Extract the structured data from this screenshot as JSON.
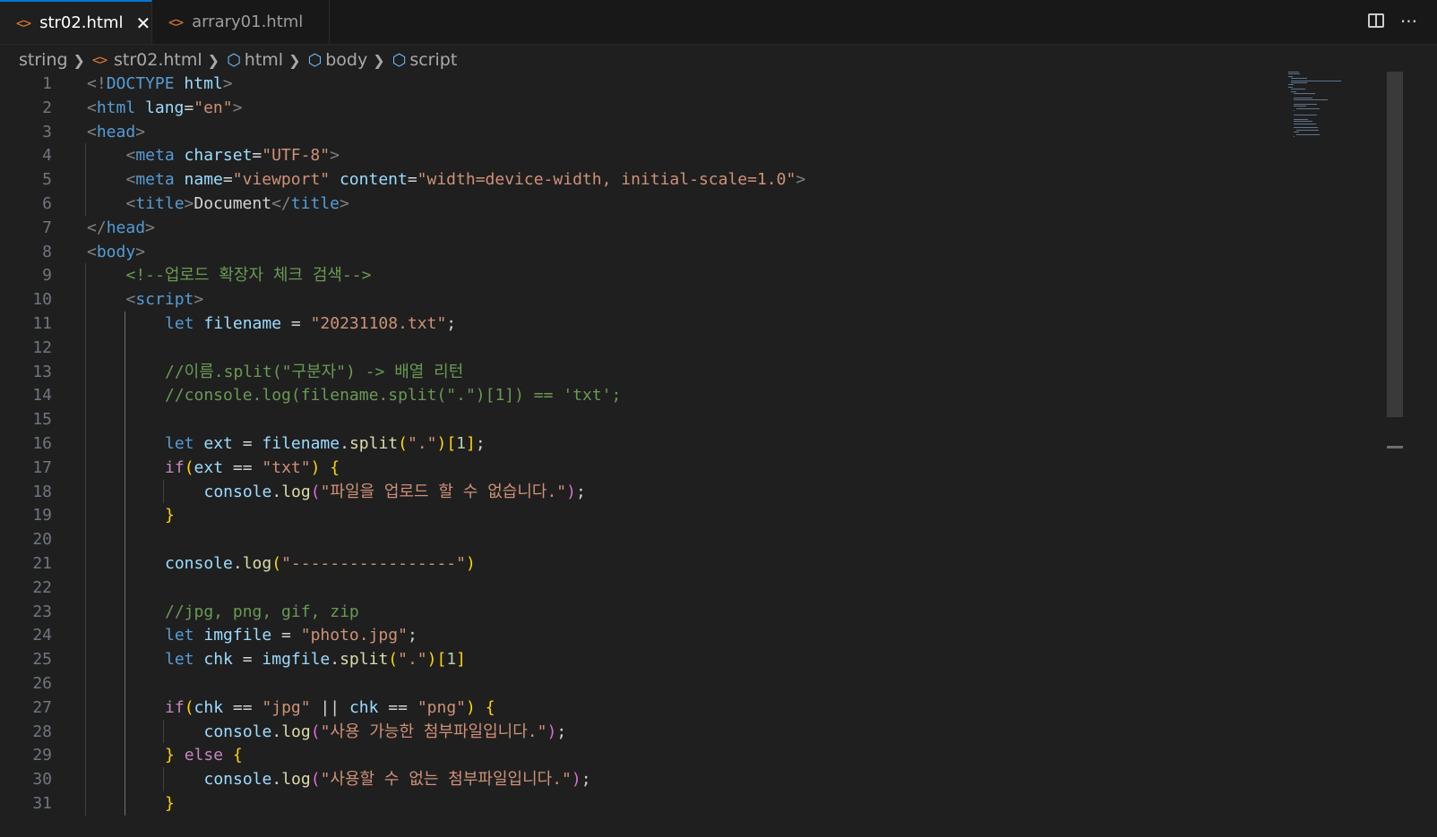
{
  "tabs": [
    {
      "label": "str02.html",
      "active": true
    },
    {
      "label": "arrary01.html",
      "active": false
    }
  ],
  "tab_actions": {
    "split_icon": "split-editor-icon",
    "more_icon": "more-actions-icon",
    "more_glyph": "···"
  },
  "breadcrumbs": [
    {
      "label": "string",
      "icon": ""
    },
    {
      "label": "str02.html",
      "icon": "html-file-icon"
    },
    {
      "label": "html",
      "icon": "symbol-cube-icon"
    },
    {
      "label": "body",
      "icon": "symbol-cube-icon"
    },
    {
      "label": "script",
      "icon": "symbol-cube-icon"
    }
  ],
  "colors": {
    "editor_bg": "#1f1f1f",
    "tabbar_bg": "#181818",
    "active_tab_border": "#0078d4",
    "html_icon": "#e37933",
    "cube_icon": "#75beff"
  },
  "code_lines": [
    {
      "n": "1",
      "indent": 0,
      "tokens": [
        [
          "tg",
          "<!"
        ],
        [
          "tn",
          "DOCTYPE"
        ],
        [
          "tx",
          " "
        ],
        [
          "at",
          "html"
        ],
        [
          "tg",
          ">"
        ]
      ]
    },
    {
      "n": "2",
      "indent": 0,
      "tokens": [
        [
          "tg",
          "<"
        ],
        [
          "tn",
          "html"
        ],
        [
          "tx",
          " "
        ],
        [
          "at",
          "lang"
        ],
        [
          "tx",
          "="
        ],
        [
          "sv",
          "\"en\""
        ],
        [
          "tg",
          ">"
        ]
      ]
    },
    {
      "n": "3",
      "indent": 0,
      "tokens": [
        [
          "tg",
          "<"
        ],
        [
          "tn",
          "head"
        ],
        [
          "tg",
          ">"
        ]
      ]
    },
    {
      "n": "4",
      "indent": 1,
      "tokens": [
        [
          "tg",
          "<"
        ],
        [
          "tn",
          "meta"
        ],
        [
          "tx",
          " "
        ],
        [
          "at",
          "charset"
        ],
        [
          "tx",
          "="
        ],
        [
          "sv",
          "\"UTF-8\""
        ],
        [
          "tg",
          ">"
        ]
      ]
    },
    {
      "n": "5",
      "indent": 1,
      "tokens": [
        [
          "tg",
          "<"
        ],
        [
          "tn",
          "meta"
        ],
        [
          "tx",
          " "
        ],
        [
          "at",
          "name"
        ],
        [
          "tx",
          "="
        ],
        [
          "sv",
          "\"viewport\""
        ],
        [
          "tx",
          " "
        ],
        [
          "at",
          "content"
        ],
        [
          "tx",
          "="
        ],
        [
          "sv",
          "\"width=device-width, initial-scale=1.0\""
        ],
        [
          "tg",
          ">"
        ]
      ]
    },
    {
      "n": "6",
      "indent": 1,
      "tokens": [
        [
          "tg",
          "<"
        ],
        [
          "tn",
          "title"
        ],
        [
          "tg",
          ">"
        ],
        [
          "tx",
          "Document"
        ],
        [
          "tg",
          "</"
        ],
        [
          "tn",
          "title"
        ],
        [
          "tg",
          ">"
        ]
      ]
    },
    {
      "n": "7",
      "indent": 0,
      "tokens": [
        [
          "tg",
          "</"
        ],
        [
          "tn",
          "head"
        ],
        [
          "tg",
          ">"
        ]
      ]
    },
    {
      "n": "8",
      "indent": 0,
      "tokens": [
        [
          "tg",
          "<"
        ],
        [
          "tn",
          "body"
        ],
        [
          "tg",
          ">"
        ]
      ]
    },
    {
      "n": "9",
      "indent": 1,
      "tokens": [
        [
          "cm",
          "<!--업로드 확장자 체크 검색-->"
        ]
      ]
    },
    {
      "n": "10",
      "indent": 1,
      "tokens": [
        [
          "tg",
          "<"
        ],
        [
          "tn",
          "script"
        ],
        [
          "tg",
          ">"
        ]
      ]
    },
    {
      "n": "11",
      "indent": 2,
      "tokens": [
        [
          "kw",
          "let"
        ],
        [
          "tx",
          " "
        ],
        [
          "vr",
          "filename"
        ],
        [
          "op",
          " = "
        ],
        [
          "sv",
          "\"20231108.txt\""
        ],
        [
          "op",
          ";"
        ]
      ]
    },
    {
      "n": "12",
      "indent": 2,
      "tokens": []
    },
    {
      "n": "13",
      "indent": 2,
      "tokens": [
        [
          "cm",
          "//이름.split(\"구분자\") -> 배열 리턴"
        ]
      ]
    },
    {
      "n": "14",
      "indent": 2,
      "tokens": [
        [
          "cm",
          "//console.log(filename.split(\".\")[1]) == 'txt';"
        ]
      ]
    },
    {
      "n": "15",
      "indent": 2,
      "tokens": []
    },
    {
      "n": "16",
      "indent": 2,
      "tokens": [
        [
          "kw",
          "let"
        ],
        [
          "tx",
          " "
        ],
        [
          "vr",
          "ext"
        ],
        [
          "op",
          " = "
        ],
        [
          "vr",
          "filename"
        ],
        [
          "op",
          "."
        ],
        [
          "fn",
          "split"
        ],
        [
          "b1",
          "("
        ],
        [
          "sv",
          "\".\""
        ],
        [
          "b1",
          ")"
        ],
        [
          "b1",
          "["
        ],
        [
          "nm",
          "1"
        ],
        [
          "b1",
          "]"
        ],
        [
          "op",
          ";"
        ]
      ]
    },
    {
      "n": "17",
      "indent": 2,
      "tokens": [
        [
          "ct",
          "if"
        ],
        [
          "b1",
          "("
        ],
        [
          "vr",
          "ext"
        ],
        [
          "op",
          " == "
        ],
        [
          "sv",
          "\"txt\""
        ],
        [
          "b1",
          ")"
        ],
        [
          "tx",
          " "
        ],
        [
          "b1",
          "{"
        ]
      ]
    },
    {
      "n": "18",
      "indent": 3,
      "tokens": [
        [
          "vr",
          "console"
        ],
        [
          "op",
          "."
        ],
        [
          "fn",
          "log"
        ],
        [
          "b2",
          "("
        ],
        [
          "sv",
          "\"파일을 업로드 할 수 없습니다.\""
        ],
        [
          "b2",
          ")"
        ],
        [
          "op",
          ";"
        ]
      ]
    },
    {
      "n": "19",
      "indent": 2,
      "tokens": [
        [
          "b1",
          "}"
        ]
      ]
    },
    {
      "n": "20",
      "indent": 2,
      "tokens": []
    },
    {
      "n": "21",
      "indent": 2,
      "tokens": [
        [
          "vr",
          "console"
        ],
        [
          "op",
          "."
        ],
        [
          "fn",
          "log"
        ],
        [
          "b1",
          "("
        ],
        [
          "sv",
          "\"-----------------\""
        ],
        [
          "b1",
          ")"
        ]
      ]
    },
    {
      "n": "22",
      "indent": 2,
      "tokens": []
    },
    {
      "n": "23",
      "indent": 2,
      "tokens": [
        [
          "cm",
          "//jpg, png, gif, zip"
        ]
      ]
    },
    {
      "n": "24",
      "indent": 2,
      "tokens": [
        [
          "kw",
          "let"
        ],
        [
          "tx",
          " "
        ],
        [
          "vr",
          "imgfile"
        ],
        [
          "op",
          " = "
        ],
        [
          "sv",
          "\"photo.jpg\""
        ],
        [
          "op",
          ";"
        ]
      ]
    },
    {
      "n": "25",
      "indent": 2,
      "tokens": [
        [
          "kw",
          "let"
        ],
        [
          "tx",
          " "
        ],
        [
          "vr",
          "chk"
        ],
        [
          "op",
          " = "
        ],
        [
          "vr",
          "imgfile"
        ],
        [
          "op",
          "."
        ],
        [
          "fn",
          "split"
        ],
        [
          "b1",
          "("
        ],
        [
          "sv",
          "\".\""
        ],
        [
          "b1",
          ")"
        ],
        [
          "b1",
          "["
        ],
        [
          "nm",
          "1"
        ],
        [
          "b1",
          "]"
        ]
      ]
    },
    {
      "n": "26",
      "indent": 2,
      "tokens": []
    },
    {
      "n": "27",
      "indent": 2,
      "tokens": [
        [
          "ct",
          "if"
        ],
        [
          "b1",
          "("
        ],
        [
          "vr",
          "chk"
        ],
        [
          "op",
          " == "
        ],
        [
          "sv",
          "\"jpg\""
        ],
        [
          "op",
          " || "
        ],
        [
          "vr",
          "chk"
        ],
        [
          "op",
          " == "
        ],
        [
          "sv",
          "\"png\""
        ],
        [
          "b1",
          ")"
        ],
        [
          "tx",
          " "
        ],
        [
          "b1",
          "{"
        ]
      ]
    },
    {
      "n": "28",
      "indent": 3,
      "tokens": [
        [
          "vr",
          "console"
        ],
        [
          "op",
          "."
        ],
        [
          "fn",
          "log"
        ],
        [
          "b2",
          "("
        ],
        [
          "sv",
          "\"사용 가능한 첨부파일입니다.\""
        ],
        [
          "b2",
          ")"
        ],
        [
          "op",
          ";"
        ]
      ]
    },
    {
      "n": "29",
      "indent": 2,
      "tokens": [
        [
          "b1",
          "}"
        ],
        [
          "tx",
          " "
        ],
        [
          "ct",
          "else"
        ],
        [
          "tx",
          " "
        ],
        [
          "b1",
          "{"
        ]
      ]
    },
    {
      "n": "30",
      "indent": 3,
      "tokens": [
        [
          "vr",
          "console"
        ],
        [
          "op",
          "."
        ],
        [
          "fn",
          "log"
        ],
        [
          "b2",
          "("
        ],
        [
          "sv",
          "\"사용할 수 없는 첨부파일입니다.\""
        ],
        [
          "b2",
          ")"
        ],
        [
          "op",
          ";"
        ]
      ]
    },
    {
      "n": "31",
      "indent": 2,
      "tokens": [
        [
          "b1",
          "}"
        ]
      ]
    }
  ]
}
